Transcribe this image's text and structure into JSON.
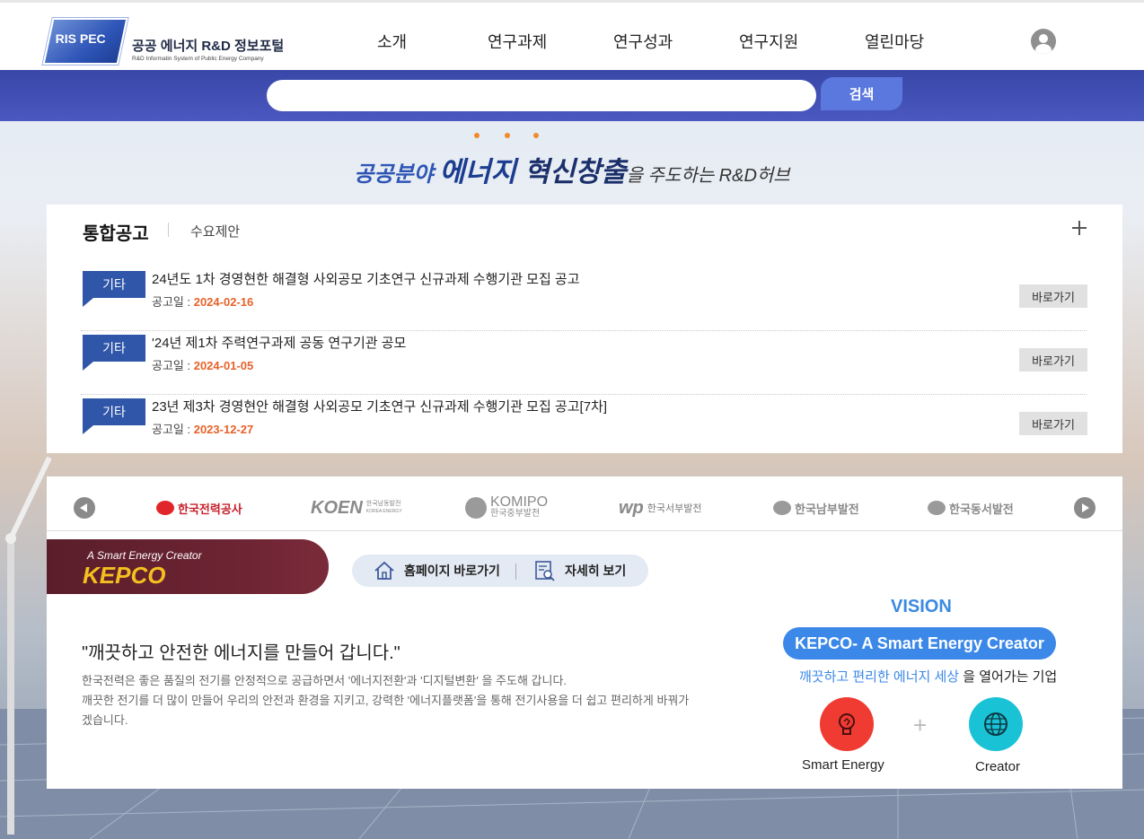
{
  "header": {
    "logo_mark": "RIS PEC",
    "logo_title": "공공 에너지 R&D 정보포털",
    "logo_subtitle": "R&D Informatin System of Public Energy Company",
    "nav": [
      "소개",
      "연구과제",
      "연구성과",
      "연구지원",
      "열린마당"
    ],
    "user_icon": "user-icon"
  },
  "search": {
    "placeholder": "",
    "value": "",
    "button_label": "검색"
  },
  "slogan": {
    "part1": "공공분야 ",
    "part2": "에너지 ",
    "part3": "혁신창출",
    "part4": "을 주도하는 R&D허브"
  },
  "notice": {
    "tab_main": "통합공고",
    "tab_sub": "수요제안",
    "date_label": "공고일 : ",
    "go_label": "바로가기",
    "items": [
      {
        "category": "기타",
        "title": "24년도 1차 경영현한 해결형 사외공모 기초연구 신규과제 수행기관 모집 공고",
        "date": "2024-02-16"
      },
      {
        "category": "기타",
        "title": "'24년 제1차 주력연구과제 공동 연구기관 공모",
        "date": "2024-01-05"
      },
      {
        "category": "기타",
        "title": "23년 제3차 경영현안 해결형 사외공모 기초연구 신규과제 수행기관 모집 공고[7차]",
        "date": "2023-12-27"
      }
    ]
  },
  "companies": {
    "logos": [
      {
        "name": "한국전력공사"
      },
      {
        "name": "KOEN",
        "sub1": "한국남동발전",
        "sub2": "KOREA ENERGY"
      },
      {
        "name": "KOMIPO",
        "sub1": "한국중부발전"
      },
      {
        "name": "wp",
        "sub1": "한국서부발전"
      },
      {
        "name": "한국남부발전"
      },
      {
        "name": "한국동서발전"
      }
    ],
    "selected": {
      "tagline": "A Smart Energy Creator",
      "name": "KEPCO",
      "homepage_label": "홈페이지 바로가기",
      "detail_label": "자세히 보기",
      "quote": "\"깨끗하고 안전한 에너지를 만들어 갑니다.\"",
      "desc_line1": "한국전력은 좋은 품질의 전기를 안정적으로 공급하면서 '에너지전환'과 '디지털변환' 을 주도해 갑니다.",
      "desc_line2": "깨끗한 전기를 더 많이 만들어 우리의 안전과 환경을 지키고, 강력한 '에너지플랫폼'을 통해 전기사용을 더 쉽고 편리하게 바꿔가겠습니다.",
      "vision_title": "VISION",
      "vision_pill": "KEPCO- A Smart Energy Creator",
      "vision_sub_highlight": "깨끗하고 편리한 에너지 세상",
      "vision_sub_rest": " 을 열어가는 기업",
      "circle1_label": "Smart Energy",
      "circle2_label": "Creator",
      "plus": "+"
    }
  },
  "colors": {
    "brand_blue": "#3947a8",
    "badge_blue": "#2f56a8",
    "date_orange": "#e6622a",
    "kepco_maroon": "#6e2433",
    "kepco_gold": "#f4c020",
    "vision_blue": "#3b88e8"
  }
}
